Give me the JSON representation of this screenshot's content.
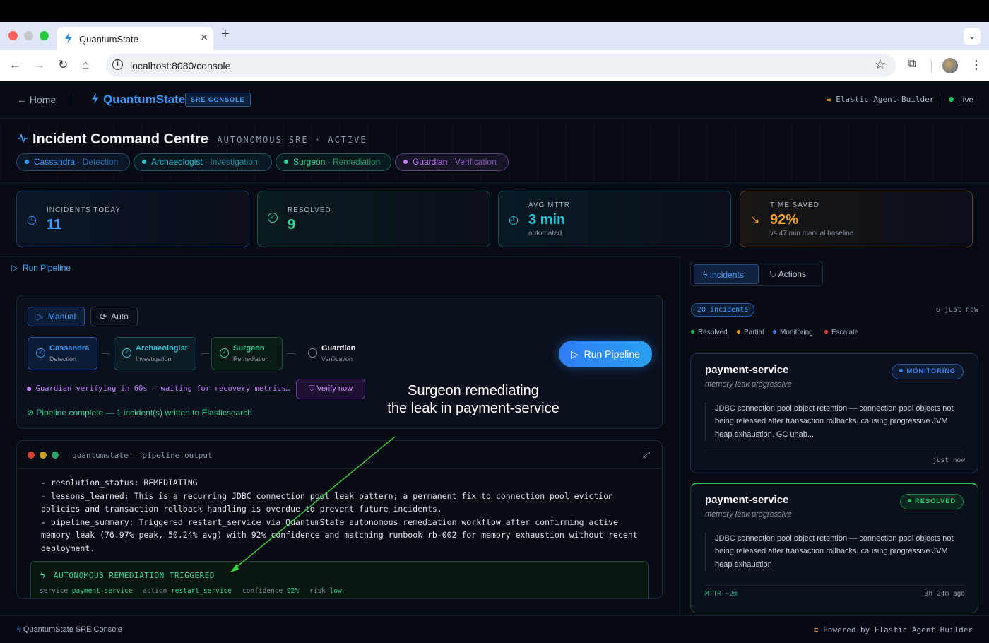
{
  "browser": {
    "tab_title": "QuantumState",
    "url": "localhost:8080/console"
  },
  "header": {
    "home_label": "Home",
    "brand": "QuantumState",
    "badge": "SRE CONSOLE",
    "elastic_label": "Elastic Agent Builder",
    "live_label": "Live"
  },
  "hero": {
    "title": "Incident Command Centre",
    "subtitle": "· AUTONOMOUS SRE · ACTIVE",
    "agents": [
      {
        "name": "Cassandra",
        "role": "· Detection",
        "color": "#3b9cff"
      },
      {
        "name": "Archaeologist",
        "role": "· Investigation",
        "color": "#22c3d6"
      },
      {
        "name": "Surgeon",
        "role": "· Remediation",
        "color": "#34d399"
      },
      {
        "name": "Guardian",
        "role": "· Verification",
        "color": "#c77dff"
      }
    ]
  },
  "stats": [
    {
      "label": "INCIDENTS TODAY",
      "value": "11",
      "note": "",
      "color": "#3b9cff"
    },
    {
      "label": "RESOLVED",
      "value": "9",
      "note": "",
      "color": "#34d399"
    },
    {
      "label": "AVG MTTR",
      "value": "3 min",
      "note": "automated",
      "color": "#22c3d6"
    },
    {
      "label": "TIME SAVED",
      "value": "92%",
      "note": "vs 47 min manual baseline",
      "color": "#f5a524"
    }
  ],
  "pipeline": {
    "section_title": "Run Pipeline",
    "modes": {
      "manual": "Manual",
      "auto": "Auto"
    },
    "steps": [
      {
        "name": "Cassandra",
        "role": "Detection"
      },
      {
        "name": "Archaeologist",
        "role": "Investigation"
      },
      {
        "name": "Surgeon",
        "role": "Remediation"
      },
      {
        "name": "Guardian",
        "role": "Verification"
      }
    ],
    "run_label": "Run Pipeline",
    "verify_status": "Guardian verifying in 60s — waiting for recovery metrics…",
    "verify_button": "Verify now",
    "complete_status": "Pipeline complete — 1 incident(s) written to Elasticsearch"
  },
  "annotation": {
    "line1": "Surgeon remediating",
    "line2": "the leak in payment-service"
  },
  "terminal": {
    "title": "quantumstate — pipeline output",
    "lines": [
      "- resolution_status: REMEDIATING",
      "- lessons_learned: This is a recurring JDBC connection pool leak pattern; a permanent fix to connection pool eviction policies and transaction rollback handling is overdue to prevent future incidents.",
      "- pipeline_summary: Triggered restart_service via QuantumState autonomous remediation workflow after confirming active memory leak (76.97% peak, 50.24% avg) with 92% confidence and matching runbook rb-002 for memory exhaustion without recent deployment."
    ],
    "remediation": {
      "heading": "AUTONOMOUS REMEDIATION TRIGGERED",
      "service_key": "service",
      "service_val": "payment-service",
      "action_key": "action",
      "action_val": "restart_service",
      "confidence_key": "confidence",
      "confidence_val": "92%",
      "risk_key": "risk",
      "risk_val": "low"
    }
  },
  "right_panel": {
    "tabs": {
      "incidents": "Incidents",
      "actions": "Actions"
    },
    "count": "20 incidents",
    "updated": "↻ just now",
    "legend": [
      {
        "label": "Resolved",
        "color": "#22c55e"
      },
      {
        "label": "Partial",
        "color": "#f59e0b"
      },
      {
        "label": "Monitoring",
        "color": "#3b82f6"
      },
      {
        "label": "Escalate",
        "color": "#ef4444"
      }
    ],
    "incidents": [
      {
        "service": "payment-service",
        "kind": "memory leak progressive",
        "status": "MONITORING",
        "description": "JDBC connection pool object retention — connection pool objects not being released after transaction rollbacks, causing progressive JVM heap exhaustion. GC unab...",
        "mttr": "",
        "time": "just now"
      },
      {
        "service": "payment-service",
        "kind": "memory leak progressive",
        "status": "RESOLVED",
        "description": "JDBC connection pool object retention — connection pool objects not being released after transaction rollbacks, causing progressive JVM heap exhaustion",
        "mttr": "MTTR ~2m",
        "time": "3h 24m ago"
      }
    ]
  },
  "footer": {
    "left": "QuantumState SRE Console",
    "right": "Powered by Elastic Agent Builder"
  }
}
